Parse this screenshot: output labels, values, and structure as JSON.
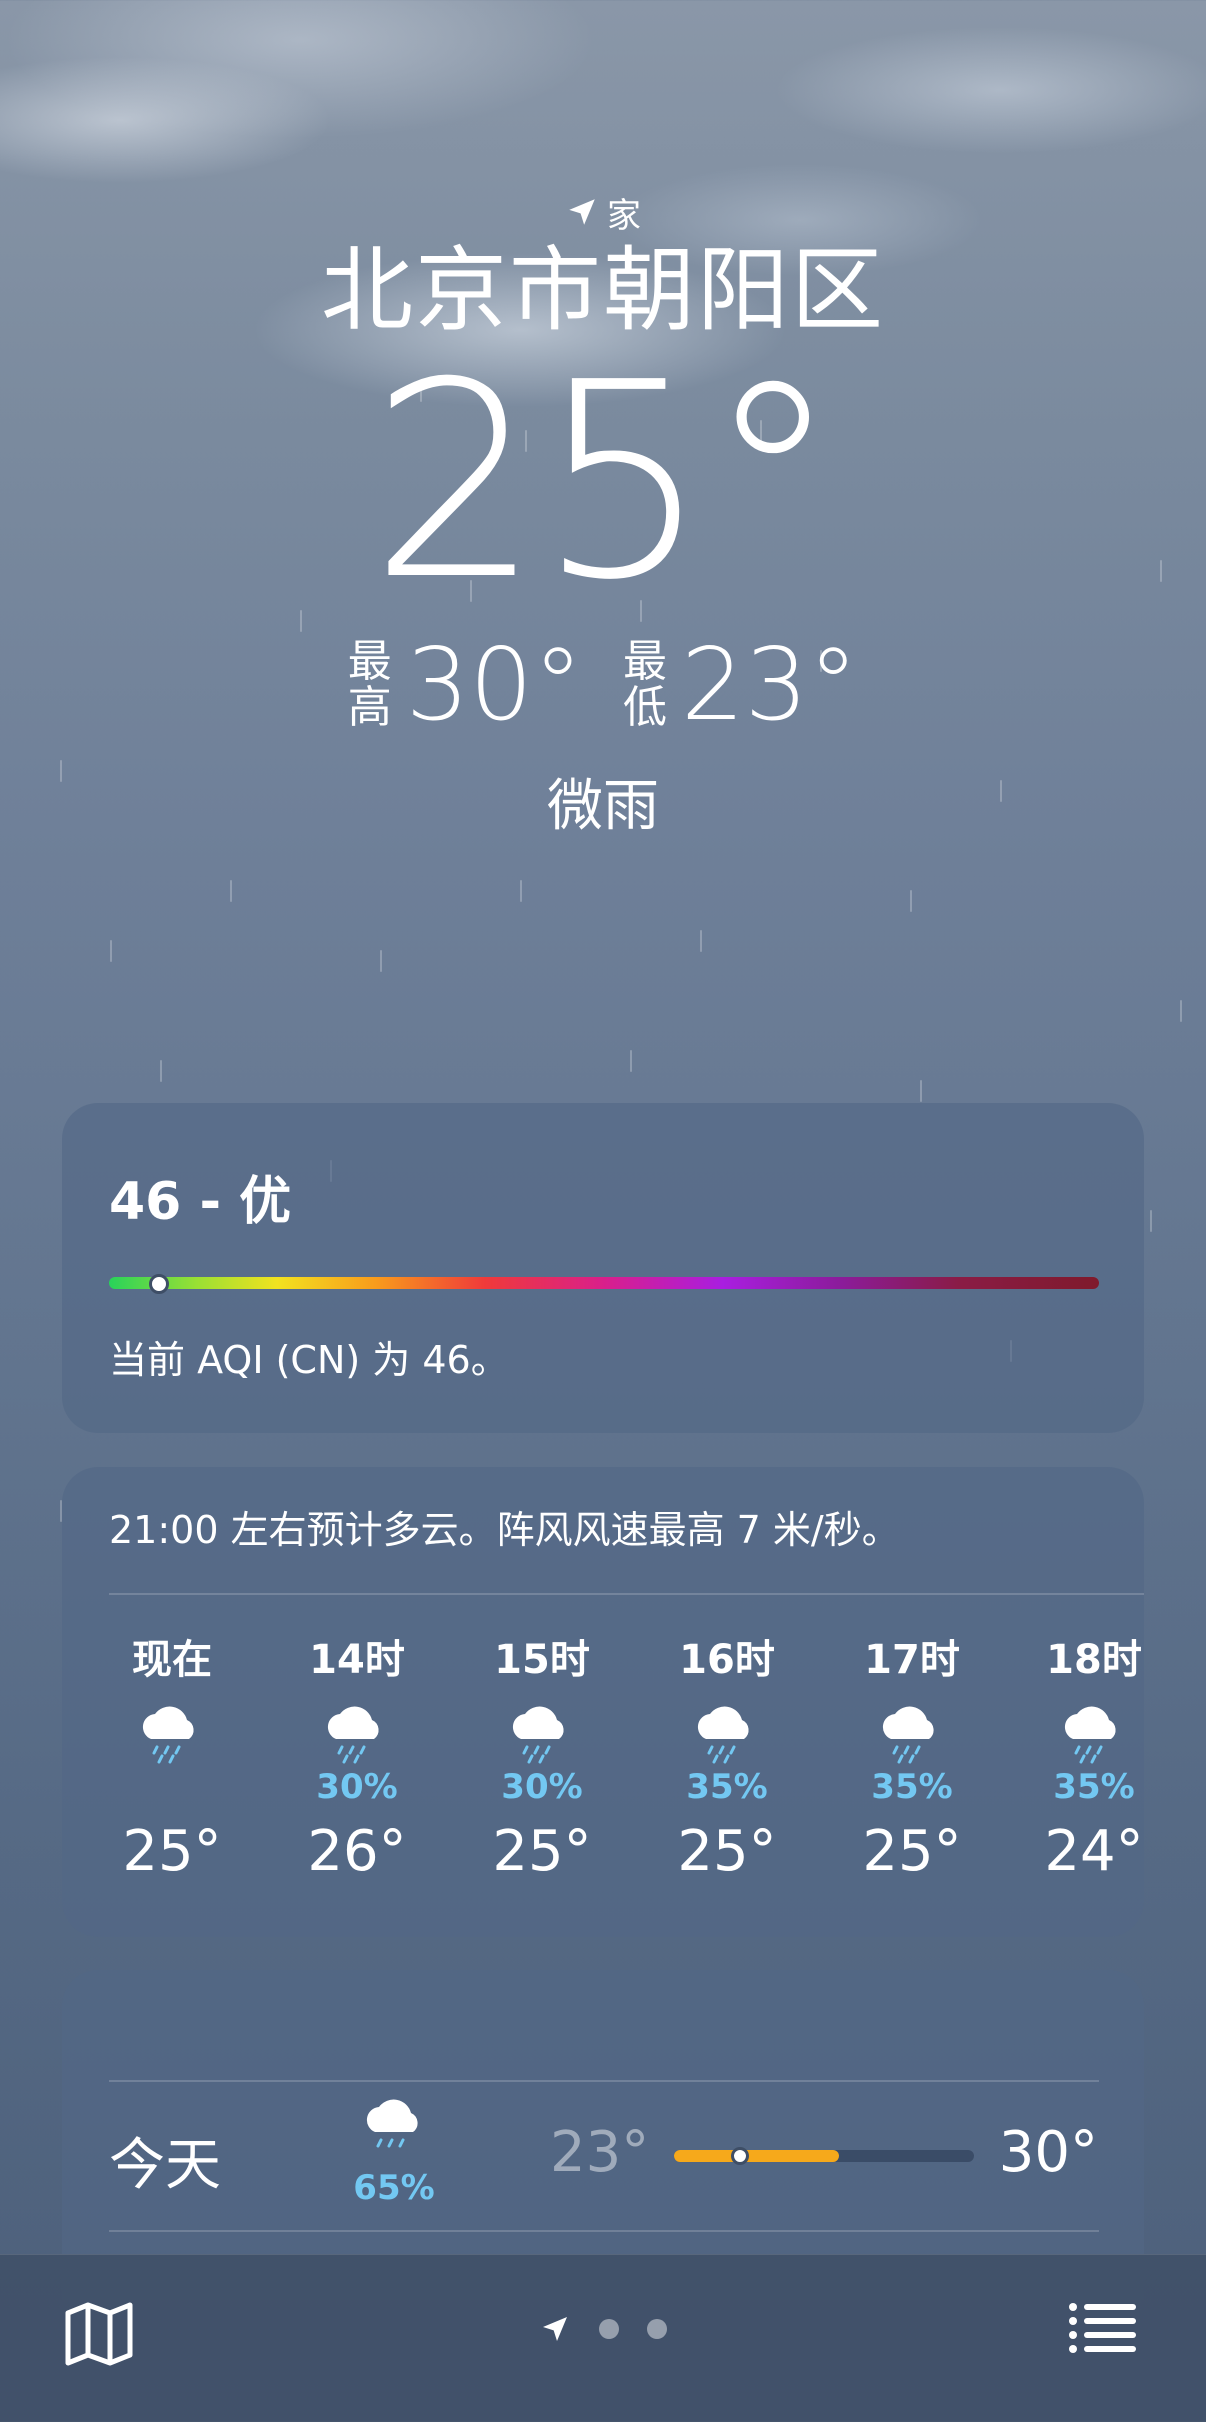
{
  "header": {
    "location_tag": "家",
    "city": "北京市朝阳区",
    "current_temp": "25°",
    "high_label_1": "最",
    "high_label_2": "高",
    "high_value": "30°",
    "low_label_1": "最",
    "low_label_2": "低",
    "low_value": "23°",
    "condition": "微雨"
  },
  "aqi": {
    "title": "46 - 优",
    "description": "当前 AQI (CN) 为 46。",
    "value": 46
  },
  "hourly": {
    "summary": "21:00 左右预计多云。阵风风速最高 7 米/秒。",
    "items": [
      {
        "time": "现在",
        "precip": "",
        "temp": "25°"
      },
      {
        "time": "14时",
        "precip": "30%",
        "temp": "26°"
      },
      {
        "time": "15时",
        "precip": "30%",
        "temp": "25°"
      },
      {
        "time": "16时",
        "precip": "35%",
        "temp": "25°"
      },
      {
        "time": "17时",
        "precip": "35%",
        "temp": "25°"
      },
      {
        "time": "18时",
        "precip": "35%",
        "temp": "24°"
      }
    ]
  },
  "daily": {
    "items": [
      {
        "day": "今天",
        "precip": "65%",
        "low": "23°",
        "high": "30°",
        "range_start": 0.0,
        "range_end": 0.55,
        "current": 0.22
      }
    ]
  },
  "tabbar": {
    "map_icon": "map-icon",
    "location_icon": "location-arrow-icon",
    "list_icon": "list-icon",
    "page_count": 3,
    "active_page": 0
  },
  "colors": {
    "precip": "#73c8f2",
    "temp_bar": "#f6a91b"
  }
}
